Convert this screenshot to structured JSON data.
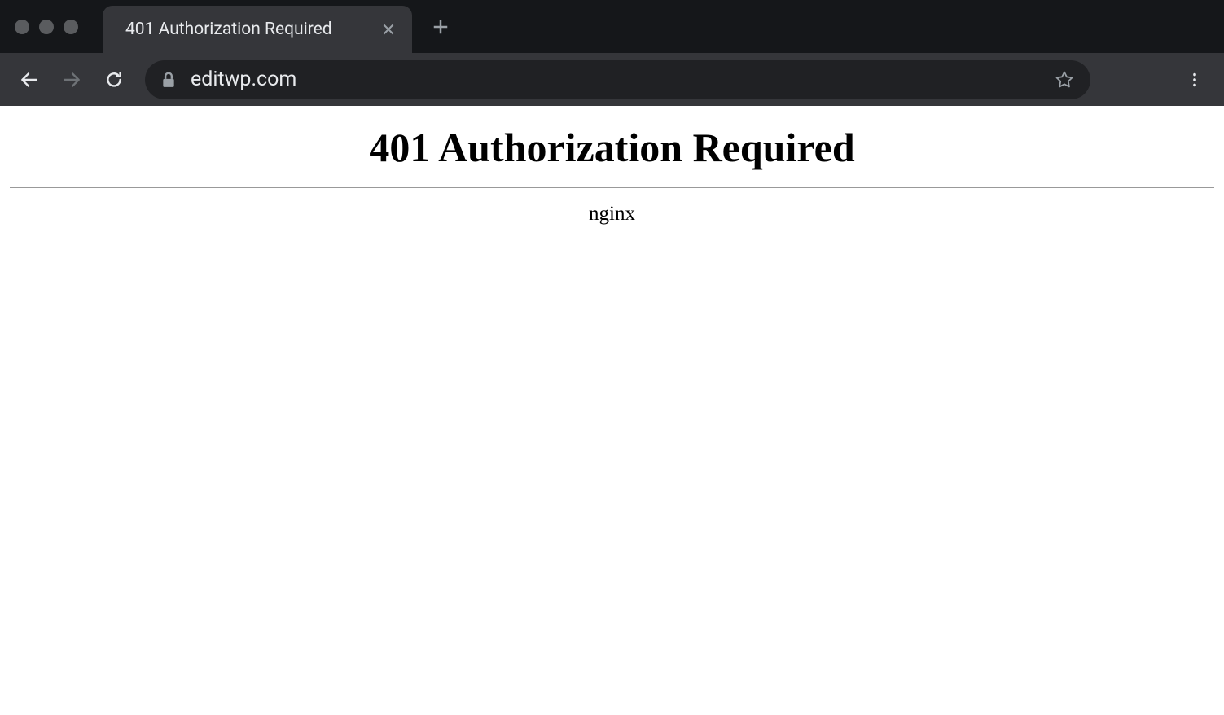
{
  "browser": {
    "tab_title": "401 Authorization Required",
    "url": "editwp.com"
  },
  "page": {
    "heading": "401 Authorization Required",
    "server": "nginx"
  }
}
